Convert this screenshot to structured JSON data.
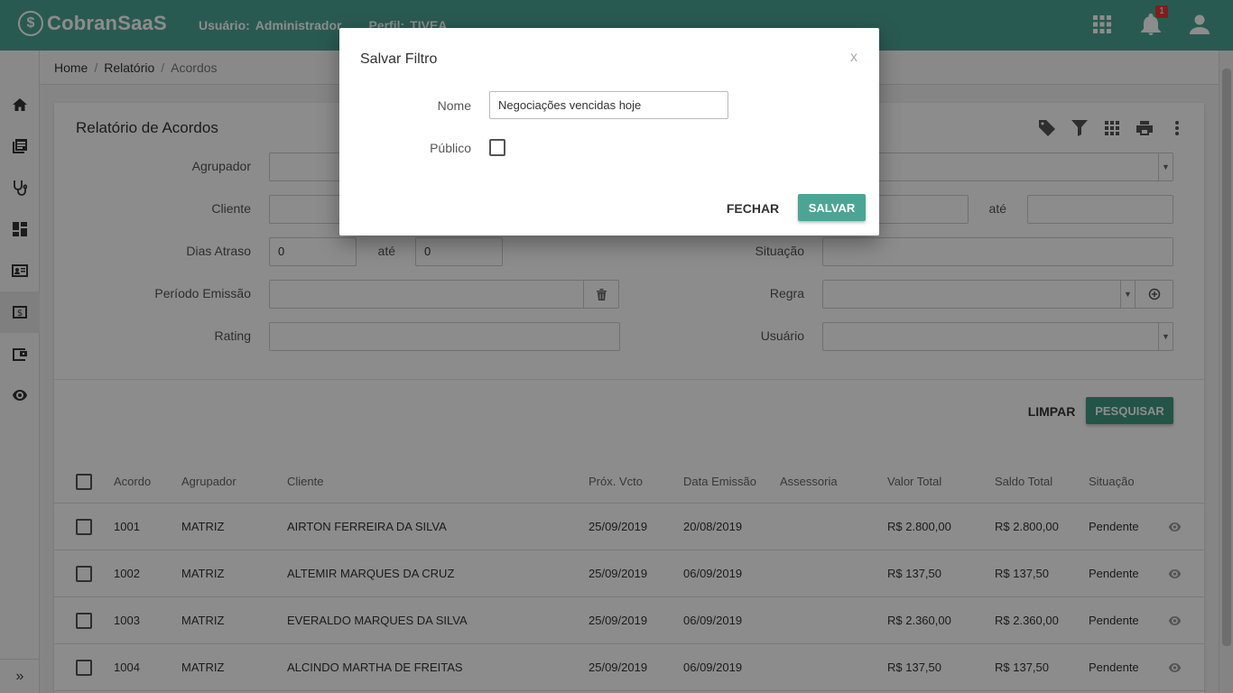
{
  "header": {
    "brand_mark": "$",
    "brand": "CobranSaaS",
    "user_label": "Usuário:",
    "user_value": "Administrador",
    "profile_label": "Perfil:",
    "profile_value": "TIVEA",
    "notification_count": "1",
    "color": "#4ca594"
  },
  "sidebar": {
    "items": [
      "home-icon",
      "books-icon",
      "stethoscope-icon",
      "dashboard-icon",
      "contact-card-icon",
      "money-icon",
      "wallet-icon",
      "eye-icon"
    ],
    "active_index": 5,
    "collapse_label": "»"
  },
  "breadcrumb": {
    "items": [
      "Home",
      "Relatório",
      "Acordos"
    ],
    "separator": "/"
  },
  "page": {
    "title": "Relatório de Acordos"
  },
  "filters": {
    "agrupador_label": "Agrupador",
    "cliente_label": "Cliente",
    "dias_atraso_label": "Dias Atraso",
    "dias_atraso_from": "0",
    "ate_label": "até",
    "dias_atraso_to": "0",
    "periodo_emissao_label": "Período Emissão",
    "rating_label": "Rating",
    "situacao_label": "Situação",
    "regra_label": "Regra",
    "usuario_label": "Usuário",
    "ate_label_right": "até",
    "clear_label": "LIMPAR",
    "search_label": "PESQUISAR"
  },
  "table": {
    "columns": [
      "Acordo",
      "Agrupador",
      "Cliente",
      "Próx. Vcto",
      "Data Emissão",
      "Assessoria",
      "Valor Total",
      "Saldo Total",
      "Situação"
    ],
    "rows": [
      {
        "acordo": "1001",
        "agrupador": "MATRIZ",
        "cliente": "AIRTON FERREIRA DA SILVA",
        "prox_vcto": "25/09/2019",
        "data_emissao": "20/08/2019",
        "assessoria": "",
        "valor_total": "R$ 2.800,00",
        "saldo_total": "R$ 2.800,00",
        "situacao": "Pendente"
      },
      {
        "acordo": "1002",
        "agrupador": "MATRIZ",
        "cliente": "ALTEMIR MARQUES DA CRUZ",
        "prox_vcto": "25/09/2019",
        "data_emissao": "06/09/2019",
        "assessoria": "",
        "valor_total": "R$ 137,50",
        "saldo_total": "R$ 137,50",
        "situacao": "Pendente"
      },
      {
        "acordo": "1003",
        "agrupador": "MATRIZ",
        "cliente": "EVERALDO MARQUES DA SILVA",
        "prox_vcto": "25/09/2019",
        "data_emissao": "06/09/2019",
        "assessoria": "",
        "valor_total": "R$ 2.360,00",
        "saldo_total": "R$ 2.360,00",
        "situacao": "Pendente"
      },
      {
        "acordo": "1004",
        "agrupador": "MATRIZ",
        "cliente": "ALCINDO MARTHA DE FREITAS",
        "prox_vcto": "25/09/2019",
        "data_emissao": "06/09/2019",
        "assessoria": "",
        "valor_total": "R$ 137,50",
        "saldo_total": "R$ 137,50",
        "situacao": "Pendente"
      }
    ]
  },
  "modal": {
    "title": "Salvar Filtro",
    "close_label": "x",
    "name_label": "Nome",
    "name_value": "Negociações vencidas hoje",
    "public_label": "Público",
    "public_checked": false,
    "cancel_label": "FECHAR",
    "save_label": "SALVAR",
    "accent": "#4ca594"
  }
}
